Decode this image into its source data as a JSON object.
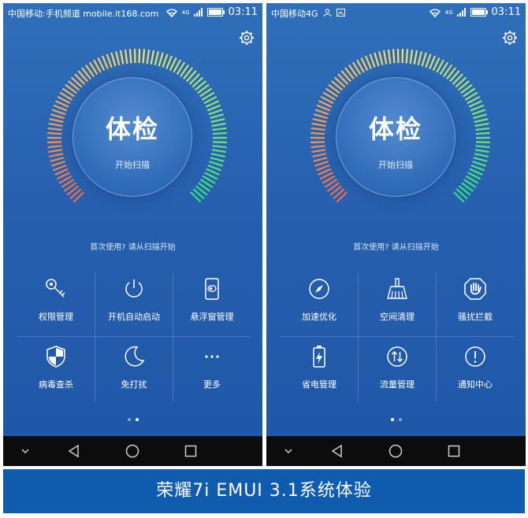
{
  "left_screen": {
    "status": {
      "left_text": "中国移动:手机频道 mobile.it168.com",
      "net": "4G",
      "time": "03:11"
    },
    "scan": {
      "title": "体检",
      "button": "开始扫描"
    },
    "hint": "首次使用? 请从扫描开始",
    "tiles": [
      {
        "label": "权限管理",
        "icon": "key-icon"
      },
      {
        "label": "开机自动启动",
        "icon": "power-icon"
      },
      {
        "label": "悬浮窗管理",
        "icon": "floating-window-icon"
      },
      {
        "label": "病毒查杀",
        "icon": "shield-icon"
      },
      {
        "label": "免打扰",
        "icon": "moon-icon"
      },
      {
        "label": "更多",
        "icon": "more-icon"
      }
    ],
    "page_indicator": {
      "count": 2,
      "active": 1
    }
  },
  "right_screen": {
    "status": {
      "left_text": "中国移动4G",
      "net": "4G",
      "time": "03:11"
    },
    "scan": {
      "title": "体检",
      "button": "开始扫描"
    },
    "hint": "首次使用? 请从扫描开始",
    "tiles": [
      {
        "label": "加速优化",
        "icon": "compass-icon"
      },
      {
        "label": "空间清理",
        "icon": "broom-icon"
      },
      {
        "label": "骚扰拦截",
        "icon": "hand-stop-icon"
      },
      {
        "label": "省电管理",
        "icon": "battery-icon"
      },
      {
        "label": "流量管理",
        "icon": "data-traffic-icon"
      },
      {
        "label": "通知中心",
        "icon": "exclamation-icon"
      }
    ],
    "page_indicator": {
      "count": 2,
      "active": 0
    }
  },
  "navbar": {
    "icons": [
      "chevron-down-icon",
      "back-icon",
      "home-icon",
      "recents-icon"
    ]
  },
  "banner": {
    "caption": "荣耀7i EMUI 3.1系统体验"
  },
  "colors": {
    "background": "#265fae",
    "navbar": "#0c0c0c",
    "banner": "#0f5cae",
    "ring_start": "#f26b4a",
    "ring_mid": "#f5e06a",
    "ring_end": "#2fe07a"
  }
}
